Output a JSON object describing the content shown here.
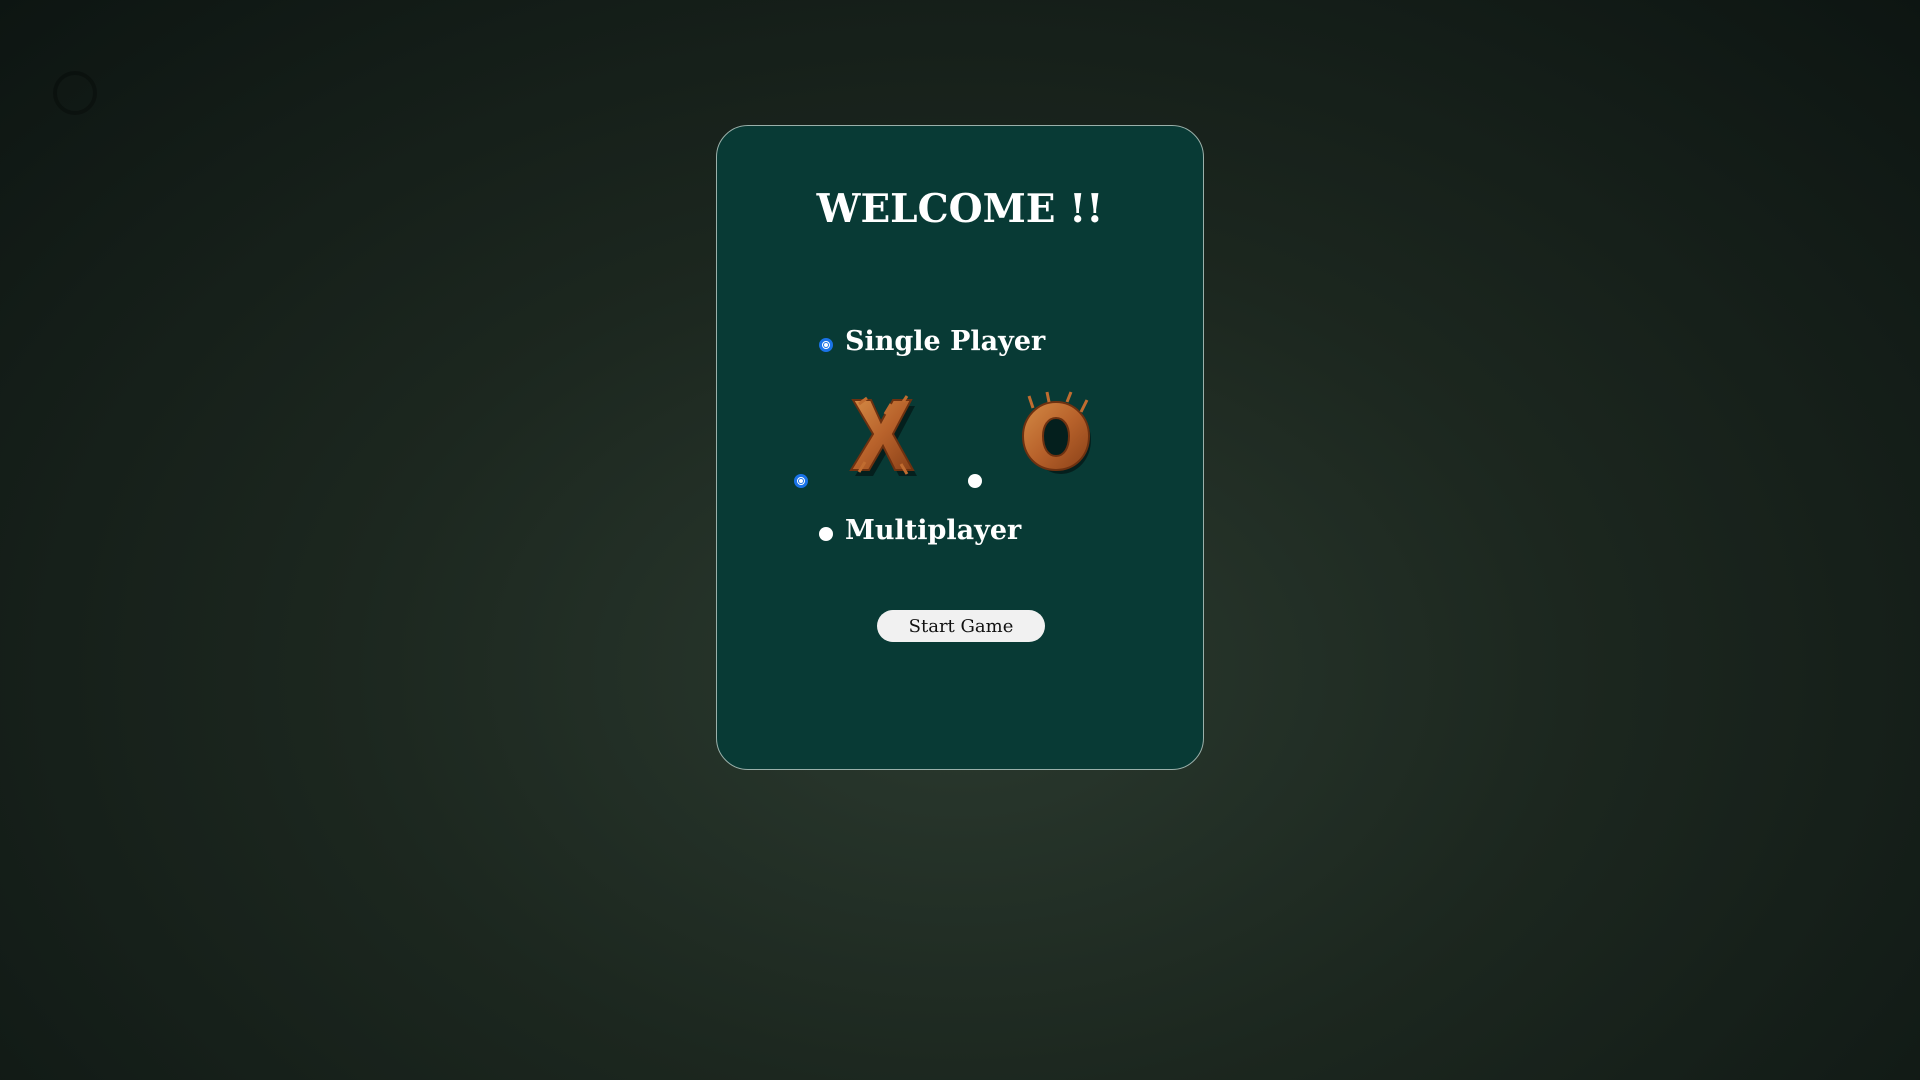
{
  "welcome_title": "WELCOME !!",
  "modes": {
    "single_label": "Single Player",
    "multi_label": "Multiplayer",
    "selected": "single"
  },
  "symbols": {
    "x_icon": "x-symbol-icon",
    "o_icon": "o-symbol-icon",
    "selected": "x"
  },
  "start_button_label": "Start Game",
  "colors": {
    "card_background": "#083a35",
    "symbol_fill": "#b8622b",
    "radio_selected": "#1a73e8"
  }
}
